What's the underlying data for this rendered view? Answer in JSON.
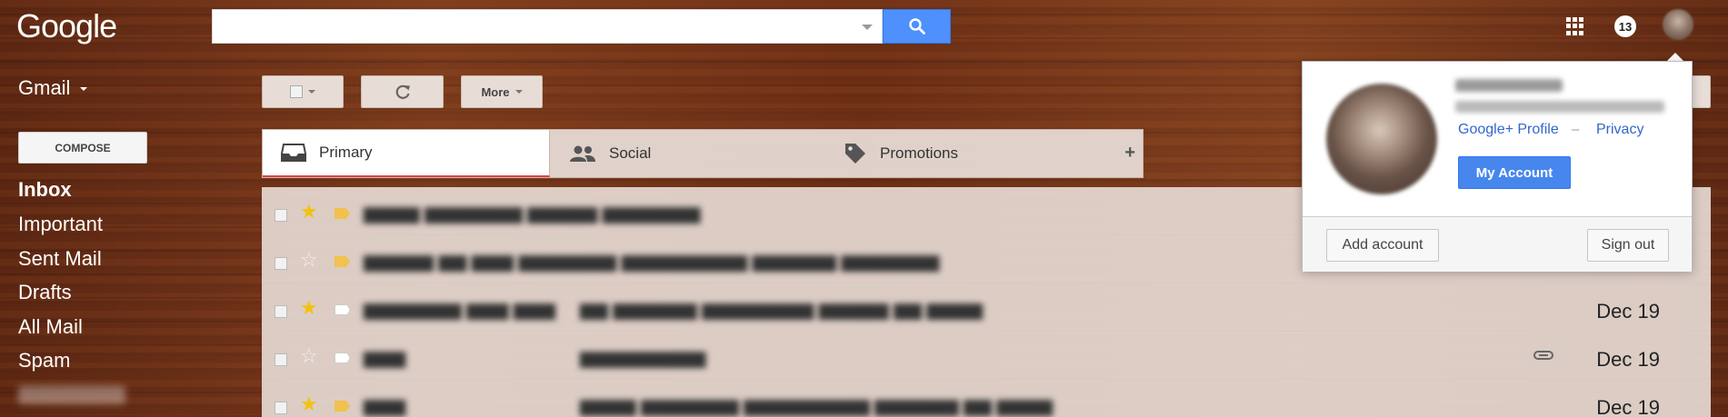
{
  "header": {
    "logo_text": "Google",
    "search": {
      "value": "",
      "placeholder": ""
    },
    "icons": {
      "search": "search-icon",
      "apps": "apps-grid-icon"
    },
    "notification_count": "13"
  },
  "nav": {
    "app_switch_label": "Gmail",
    "compose_label": "COMPOSE",
    "items": [
      {
        "label": "Inbox",
        "active": true
      },
      {
        "label": "Important",
        "active": false
      },
      {
        "label": "Sent Mail",
        "active": false
      },
      {
        "label": "Drafts",
        "active": false
      },
      {
        "label": "All Mail",
        "active": false
      },
      {
        "label": "Spam",
        "active": false
      }
    ]
  },
  "toolbar": {
    "more_label": "More",
    "icons": {
      "select": "checkbox-icon",
      "refresh": "refresh-icon"
    }
  },
  "tabs": [
    {
      "label": "Primary",
      "icon": "inbox-icon",
      "active": true
    },
    {
      "label": "Social",
      "icon": "people-icon",
      "active": false
    },
    {
      "label": "Promotions",
      "icon": "tag-icon",
      "active": false
    }
  ],
  "tabs_add_label": "+",
  "emails": [
    {
      "starred": true,
      "label_color": "#f2c14e",
      "date": "",
      "has_attachment": false
    },
    {
      "starred": false,
      "label_color": "#f2c14e",
      "date": "",
      "has_attachment": false
    },
    {
      "starred": true,
      "label_color": "#ffffff",
      "date": "Dec 19",
      "has_attachment": false
    },
    {
      "starred": false,
      "label_color": "#ffffff",
      "date": "Dec 19",
      "has_attachment": true
    },
    {
      "starred": true,
      "label_color": "#f2c14e",
      "date": "Dec 19",
      "has_attachment": false
    }
  ],
  "account_popup": {
    "profile_link": "Google+ Profile",
    "separator": "–",
    "privacy_link": "Privacy",
    "my_account_label": "My Account",
    "add_account_label": "Add account",
    "sign_out_label": "Sign out"
  },
  "colors": {
    "accent_blue": "#4d90fe",
    "star_yellow": "#f4c20d",
    "active_tab_underline": "#dd4444",
    "link_blue": "#3366cc"
  }
}
